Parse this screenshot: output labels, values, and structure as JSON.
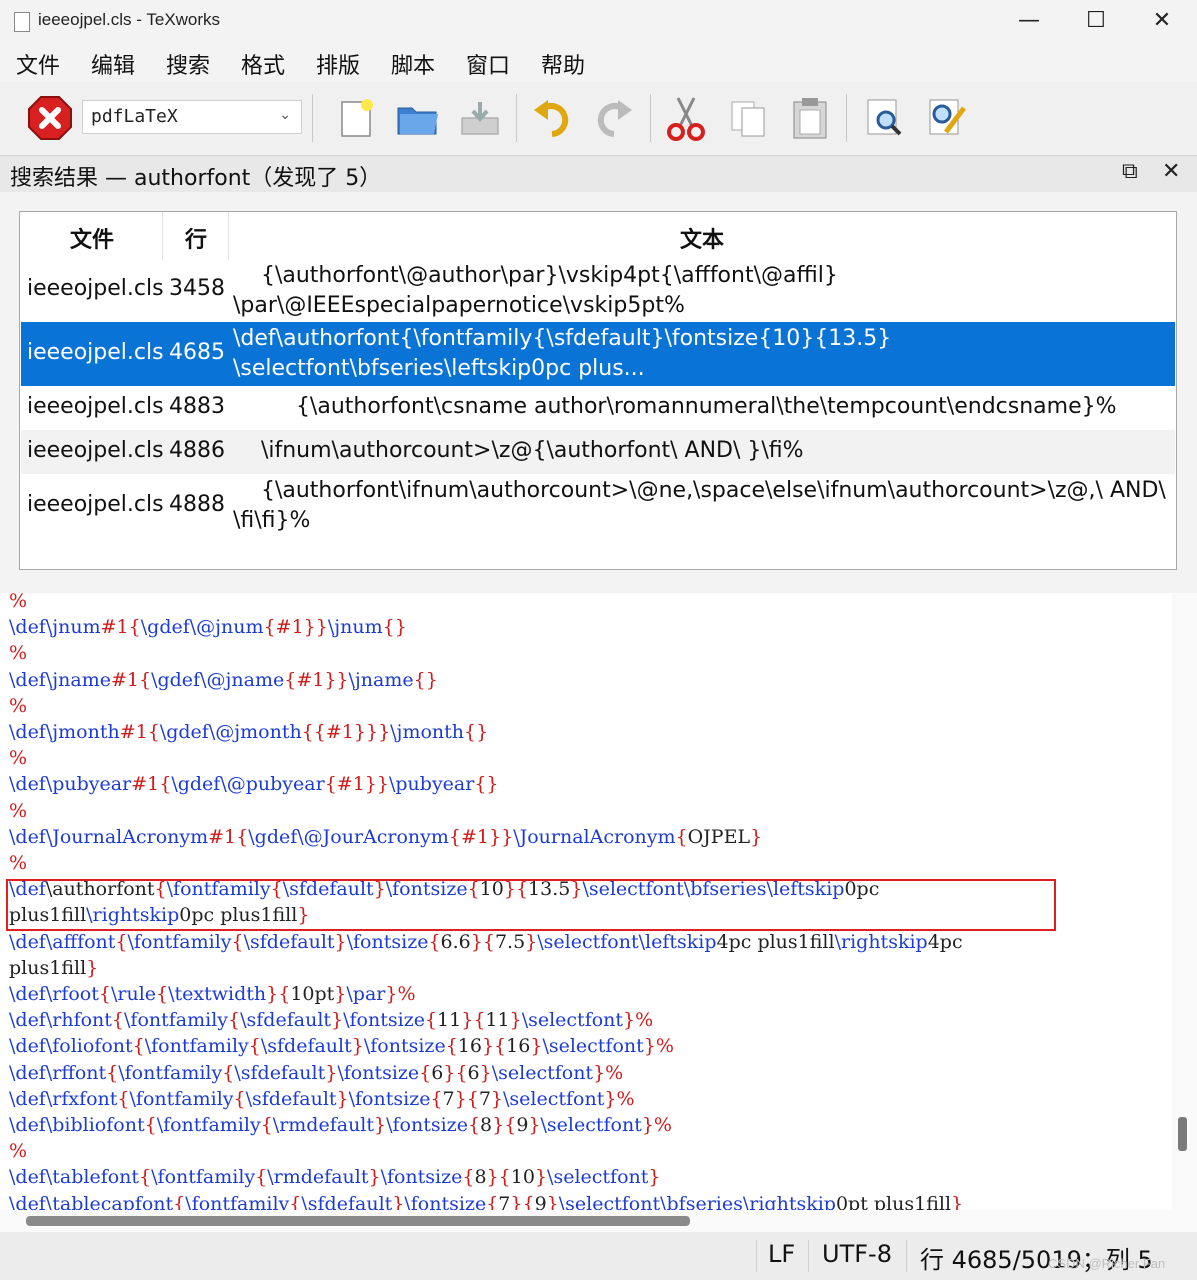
{
  "window": {
    "title": "ieeeojpel.cls - TeXworks"
  },
  "menu": [
    "文件",
    "编辑",
    "搜索",
    "格式",
    "排版",
    "脚本",
    "窗口",
    "帮助"
  ],
  "toolbar": {
    "engine": "pdfLaTeX",
    "icons": [
      "stop-typeset-icon",
      "new-doc-icon",
      "open-folder-icon",
      "save-icon",
      "undo-icon",
      "redo-icon",
      "cut-icon",
      "copy-icon",
      "paste-icon",
      "find-icon",
      "replace-icon"
    ]
  },
  "search_panel": {
    "title": "搜索结果 — authorfont（发现了 5）",
    "columns": [
      "文件",
      "行",
      "文本"
    ],
    "rows": [
      {
        "file": "ieeeojpel.cls",
        "line": "3458",
        "text": "    {\\authorfont\\@author\\par}\\vskip4pt{\\afffont\\@affil}\n\\par\\@IEEEspecialpapernotice\\vskip5pt%"
      },
      {
        "file": "ieeeojpel.cls",
        "line": "4685",
        "text": "\\def\\authorfont{\\fontfamily{\\sfdefault}\\fontsize{10}{13.5}\n\\selectfont\\bfseries\\leftskip0pc plus..."
      },
      {
        "file": "ieeeojpel.cls",
        "line": "4883",
        "text": "         {\\authorfont\\csname author\\romannumeral\\the\\tempcount\\endcsname}%"
      },
      {
        "file": "ieeeojpel.cls",
        "line": "4886",
        "text": "    \\ifnum\\authorcount>\\z@{\\authorfont\\ AND\\ }\\fi%"
      },
      {
        "file": "ieeeojpel.cls",
        "line": "4888",
        "text": "    {\\authorfont\\ifnum\\authorcount>\\@ne,\\space\\else\\ifnum\\authorcount>\\z@,\\ AND\\\n\\fi\\fi}%"
      }
    ]
  },
  "editor": {
    "lines": [
      [
        [
          "%",
          "red"
        ]
      ],
      [
        [
          "\\def",
          "blue"
        ],
        [
          "\\jnum",
          "blue"
        ],
        [
          "#1",
          "red"
        ],
        [
          "{",
          "red"
        ],
        [
          "\\gdef",
          "blue"
        ],
        [
          "\\@jnum",
          "blue"
        ],
        [
          "{",
          "red"
        ],
        [
          "#1",
          "red"
        ],
        [
          "}}",
          "red"
        ],
        [
          "\\jnum",
          "blue"
        ],
        [
          "{}",
          "red"
        ]
      ],
      [
        [
          "%",
          "red"
        ]
      ],
      [
        [
          "\\def",
          "blue"
        ],
        [
          "\\jname",
          "blue"
        ],
        [
          "#1",
          "red"
        ],
        [
          "{",
          "red"
        ],
        [
          "\\gdef",
          "blue"
        ],
        [
          "\\@jname",
          "blue"
        ],
        [
          "{",
          "red"
        ],
        [
          "#1",
          "red"
        ],
        [
          "}}",
          "red"
        ],
        [
          "\\jname",
          "blue"
        ],
        [
          "{}",
          "red"
        ]
      ],
      [
        [
          "%",
          "red"
        ]
      ],
      [
        [
          "\\def",
          "blue"
        ],
        [
          "\\jmonth",
          "blue"
        ],
        [
          "#1",
          "red"
        ],
        [
          "{",
          "red"
        ],
        [
          "\\gdef",
          "blue"
        ],
        [
          "\\@jmonth",
          "blue"
        ],
        [
          "{{",
          "red"
        ],
        [
          "#1",
          "red"
        ],
        [
          "}}}",
          "red"
        ],
        [
          "\\jmonth",
          "blue"
        ],
        [
          "{}",
          "red"
        ]
      ],
      [
        [
          "%",
          "red"
        ]
      ],
      [
        [
          "\\def",
          "blue"
        ],
        [
          "\\pubyear",
          "blue"
        ],
        [
          "#1",
          "red"
        ],
        [
          "{",
          "red"
        ],
        [
          "\\gdef",
          "blue"
        ],
        [
          "\\@pubyear",
          "blue"
        ],
        [
          "{",
          "red"
        ],
        [
          "#1",
          "red"
        ],
        [
          "}}",
          "red"
        ],
        [
          "\\pubyear",
          "blue"
        ],
        [
          "{}",
          "red"
        ]
      ],
      [
        [
          "%",
          "red"
        ]
      ],
      [
        [
          "\\def",
          "blue"
        ],
        [
          "\\JournalAcronym",
          "blue"
        ],
        [
          "#1",
          "red"
        ],
        [
          "{",
          "red"
        ],
        [
          "\\gdef",
          "blue"
        ],
        [
          "\\@JourAcronym",
          "blue"
        ],
        [
          "{",
          "red"
        ],
        [
          "#1",
          "red"
        ],
        [
          "}}",
          "red"
        ],
        [
          "\\JournalAcronym",
          "blue"
        ],
        [
          "{",
          "red"
        ],
        [
          "OJPEL",
          "blk"
        ],
        [
          "}",
          "red"
        ]
      ],
      [
        [
          "%",
          "red"
        ]
      ],
      [
        [
          "\\def",
          "blue"
        ],
        [
          "\\authorfont",
          "blk"
        ],
        [
          "{",
          "red"
        ],
        [
          "\\fontfamily",
          "blue"
        ],
        [
          "{",
          "red"
        ],
        [
          "\\sfdefault",
          "blue"
        ],
        [
          "}",
          "red"
        ],
        [
          "\\fontsize",
          "blue"
        ],
        [
          "{",
          "red"
        ],
        [
          "10",
          "blk"
        ],
        [
          "}{",
          "red"
        ],
        [
          "13.5",
          "blk"
        ],
        [
          "}",
          "red"
        ],
        [
          "\\selectfont",
          "blue"
        ],
        [
          "\\bfseries",
          "blue"
        ],
        [
          "\\leftskip",
          "blue"
        ],
        [
          "0pc",
          "blk"
        ]
      ],
      [
        [
          "plus1fill",
          "blk"
        ],
        [
          "\\rightskip",
          "blue"
        ],
        [
          "0pc plus1fill",
          "blk"
        ],
        [
          "}",
          "red"
        ]
      ],
      [
        [
          "\\def",
          "blue"
        ],
        [
          "\\afffont",
          "blue"
        ],
        [
          "{",
          "red"
        ],
        [
          "\\fontfamily",
          "blue"
        ],
        [
          "{",
          "red"
        ],
        [
          "\\sfdefault",
          "blue"
        ],
        [
          "}",
          "red"
        ],
        [
          "\\fontsize",
          "blue"
        ],
        [
          "{",
          "red"
        ],
        [
          "6.6",
          "blk"
        ],
        [
          "}{",
          "red"
        ],
        [
          "7.5",
          "blk"
        ],
        [
          "}",
          "red"
        ],
        [
          "\\selectfont",
          "blue"
        ],
        [
          "\\leftskip",
          "blue"
        ],
        [
          "4pc plus1fill",
          "blk"
        ],
        [
          "\\rightskip",
          "blue"
        ],
        [
          "4pc",
          "blk"
        ]
      ],
      [
        [
          "plus1fill",
          "blk"
        ],
        [
          "}",
          "red"
        ]
      ],
      [
        [
          "\\def",
          "blue"
        ],
        [
          "\\rfoot",
          "blue"
        ],
        [
          "{",
          "red"
        ],
        [
          "\\rule",
          "blue"
        ],
        [
          "{",
          "red"
        ],
        [
          "\\textwidth",
          "blue"
        ],
        [
          "}{",
          "red"
        ],
        [
          "10pt",
          "blk"
        ],
        [
          "}",
          "red"
        ],
        [
          "\\par",
          "blue"
        ],
        [
          "}%",
          "red"
        ]
      ],
      [
        [
          "\\def",
          "blue"
        ],
        [
          "\\rhfont",
          "blue"
        ],
        [
          "{",
          "red"
        ],
        [
          "\\fontfamily",
          "blue"
        ],
        [
          "{",
          "red"
        ],
        [
          "\\sfdefault",
          "blue"
        ],
        [
          "}",
          "red"
        ],
        [
          "\\fontsize",
          "blue"
        ],
        [
          "{",
          "red"
        ],
        [
          "11",
          "blk"
        ],
        [
          "}{",
          "red"
        ],
        [
          "11",
          "blk"
        ],
        [
          "}",
          "red"
        ],
        [
          "\\selectfont",
          "blue"
        ],
        [
          "}%",
          "red"
        ]
      ],
      [
        [
          "\\def",
          "blue"
        ],
        [
          "\\foliofont",
          "blue"
        ],
        [
          "{",
          "red"
        ],
        [
          "\\fontfamily",
          "blue"
        ],
        [
          "{",
          "red"
        ],
        [
          "\\sfdefault",
          "blue"
        ],
        [
          "}",
          "red"
        ],
        [
          "\\fontsize",
          "blue"
        ],
        [
          "{",
          "red"
        ],
        [
          "16",
          "blk"
        ],
        [
          "}{",
          "red"
        ],
        [
          "16",
          "blk"
        ],
        [
          "}",
          "red"
        ],
        [
          "\\selectfont",
          "blue"
        ],
        [
          "}%",
          "red"
        ]
      ],
      [
        [
          "\\def",
          "blue"
        ],
        [
          "\\rffont",
          "blue"
        ],
        [
          "{",
          "red"
        ],
        [
          "\\fontfamily",
          "blue"
        ],
        [
          "{",
          "red"
        ],
        [
          "\\sfdefault",
          "blue"
        ],
        [
          "}",
          "red"
        ],
        [
          "\\fontsize",
          "blue"
        ],
        [
          "{",
          "red"
        ],
        [
          "6",
          "blk"
        ],
        [
          "}{",
          "red"
        ],
        [
          "6",
          "blk"
        ],
        [
          "}",
          "red"
        ],
        [
          "\\selectfont",
          "blue"
        ],
        [
          "}%",
          "red"
        ]
      ],
      [
        [
          "\\def",
          "blue"
        ],
        [
          "\\rfxfont",
          "blue"
        ],
        [
          "{",
          "red"
        ],
        [
          "\\fontfamily",
          "blue"
        ],
        [
          "{",
          "red"
        ],
        [
          "\\sfdefault",
          "blue"
        ],
        [
          "}",
          "red"
        ],
        [
          "\\fontsize",
          "blue"
        ],
        [
          "{",
          "red"
        ],
        [
          "7",
          "blk"
        ],
        [
          "}{",
          "red"
        ],
        [
          "7",
          "blk"
        ],
        [
          "}",
          "red"
        ],
        [
          "\\selectfont",
          "blue"
        ],
        [
          "}%",
          "red"
        ]
      ],
      [
        [
          "\\def",
          "blue"
        ],
        [
          "\\bibliofont",
          "blue"
        ],
        [
          "{",
          "red"
        ],
        [
          "\\fontfamily",
          "blue"
        ],
        [
          "{",
          "red"
        ],
        [
          "\\rmdefault",
          "blue"
        ],
        [
          "}",
          "red"
        ],
        [
          "\\fontsize",
          "blue"
        ],
        [
          "{",
          "red"
        ],
        [
          "8",
          "blk"
        ],
        [
          "}{",
          "red"
        ],
        [
          "9",
          "blk"
        ],
        [
          "}",
          "red"
        ],
        [
          "\\selectfont",
          "blue"
        ],
        [
          "}%",
          "red"
        ]
      ],
      [
        [
          "%",
          "red"
        ]
      ],
      [
        [
          "\\def",
          "blue"
        ],
        [
          "\\tablefont",
          "blue"
        ],
        [
          "{",
          "red"
        ],
        [
          "\\fontfamily",
          "blue"
        ],
        [
          "{",
          "red"
        ],
        [
          "\\rmdefault",
          "blue"
        ],
        [
          "}",
          "red"
        ],
        [
          "\\fontsize",
          "blue"
        ],
        [
          "{",
          "red"
        ],
        [
          "8",
          "blk"
        ],
        [
          "}{",
          "red"
        ],
        [
          "10",
          "blk"
        ],
        [
          "}",
          "red"
        ],
        [
          "\\selectfont",
          "blue"
        ],
        [
          "}",
          "red"
        ]
      ],
      [
        [
          "\\def",
          "blue"
        ],
        [
          "\\tablecapfont",
          "blue"
        ],
        [
          "{",
          "red"
        ],
        [
          "\\fontfamily",
          "blue"
        ],
        [
          "{",
          "red"
        ],
        [
          "\\sfdefault",
          "blue"
        ],
        [
          "}",
          "red"
        ],
        [
          "\\fontsize",
          "blue"
        ],
        [
          "{",
          "red"
        ],
        [
          "7",
          "blk"
        ],
        [
          "}{",
          "red"
        ],
        [
          "9",
          "blk"
        ],
        [
          "}",
          "red"
        ],
        [
          "\\selectfont",
          "blue"
        ],
        [
          "\\bfseries",
          "blue"
        ],
        [
          "\\rightskip",
          "blue"
        ],
        [
          "0pt plus1fill",
          "blk"
        ],
        [
          "}",
          "red"
        ]
      ]
    ]
  },
  "status": {
    "eol": "LF",
    "encoding": "UTF-8",
    "position": "行 4685/5019；列 5"
  },
  "watermark": "CSDN @Richer Fan",
  "colors": {
    "selection": "#0a74d6",
    "command": "#1c3bd4",
    "brace": "#d11a1a",
    "highlight_box": "#e02020"
  }
}
